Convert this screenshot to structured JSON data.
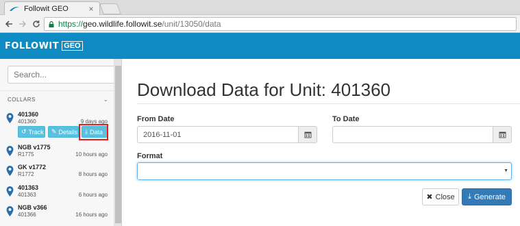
{
  "browser": {
    "tab_title": "Followit GEO",
    "tab_close": "×",
    "url_scheme": "https://",
    "url_host": "geo.wildlife.followit.se",
    "url_path": "/unit/13050/data"
  },
  "header": {
    "logo_text": "FOLLOWIT",
    "logo_badge": "GEO",
    "color": "#0f8bc4"
  },
  "sidebar": {
    "search_placeholder": "Search...",
    "section_title": "COLLARS",
    "units": [
      {
        "name": "401360",
        "sub": "401360",
        "time": "9 days ago"
      },
      {
        "name": "NGB v1775",
        "sub": "R1775",
        "time": "10 hours ago"
      },
      {
        "name": "GK v1772",
        "sub": "R1772",
        "time": "8 hours ago"
      },
      {
        "name": "401363",
        "sub": "401363",
        "time": "6 hours ago"
      },
      {
        "name": "NGB v366",
        "sub": "401366",
        "time": "16 hours ago"
      }
    ],
    "actions": {
      "track": "Track",
      "details": "Details",
      "data": "Data"
    }
  },
  "main": {
    "title": "Download Data for Unit: 401360",
    "from_label": "From Date",
    "from_value": "2016-11-01",
    "to_label": "To Date",
    "to_value": "",
    "format_label": "Format",
    "format_value": "",
    "close_label": "Close",
    "generate_label": "Generate"
  }
}
